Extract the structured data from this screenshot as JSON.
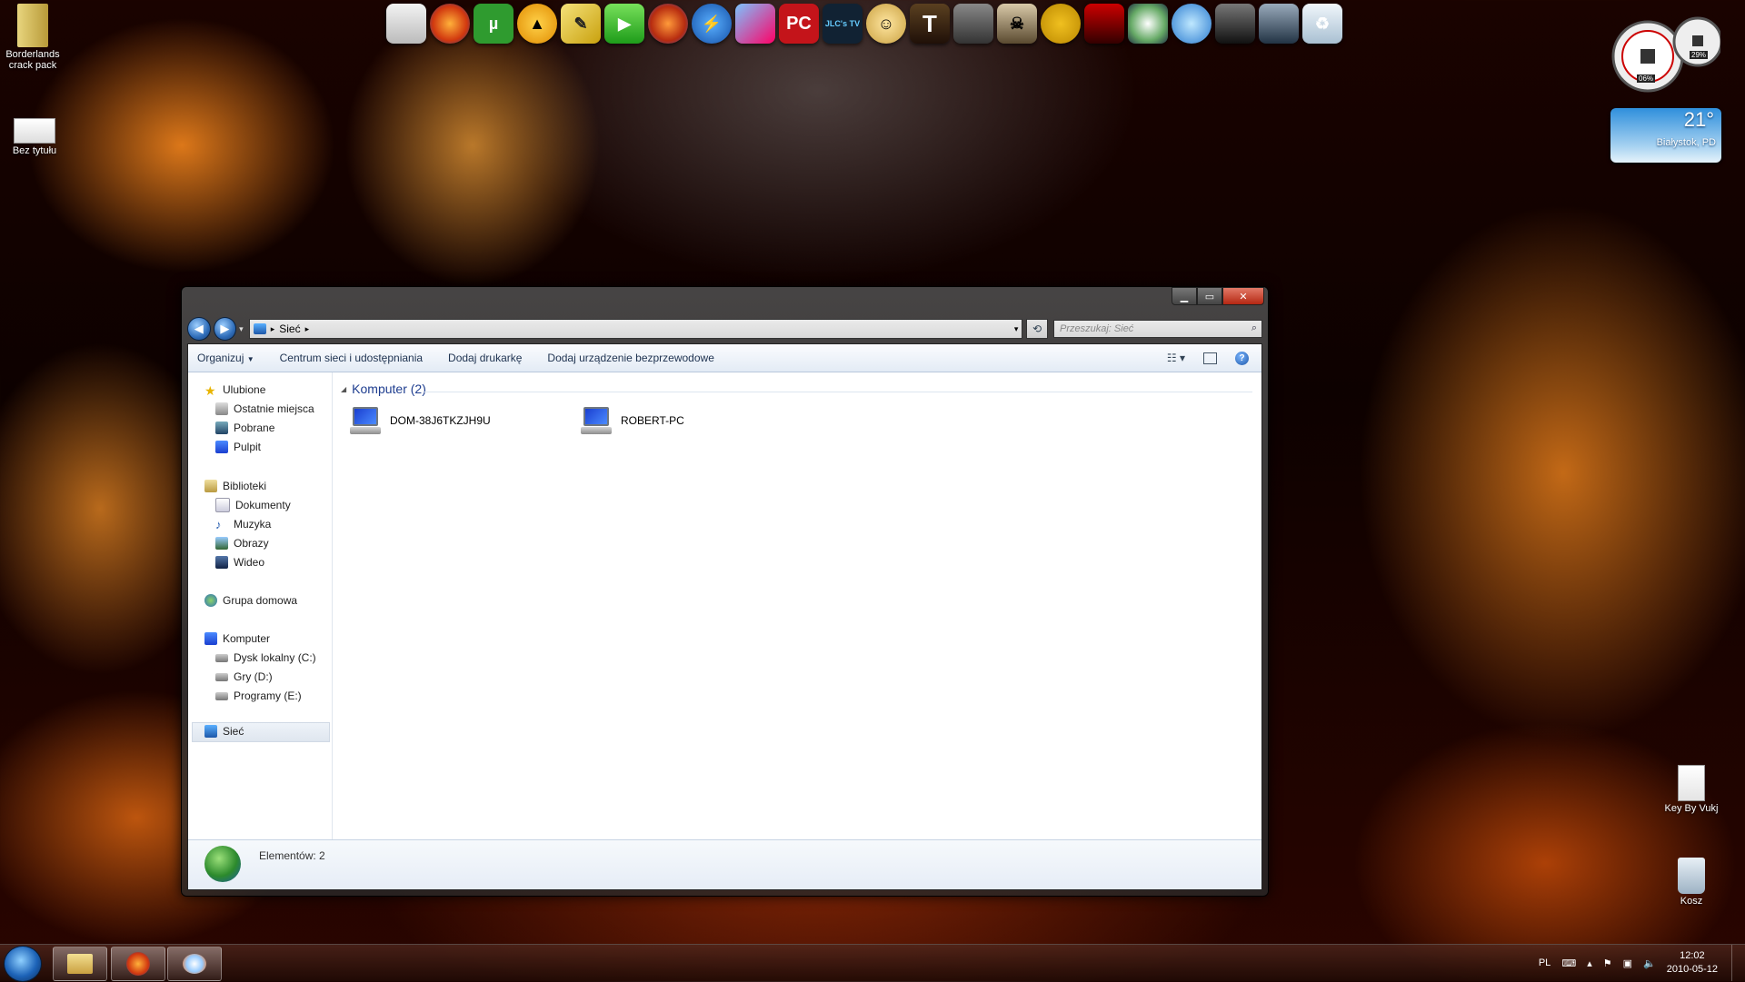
{
  "desktop": {
    "icons": [
      {
        "label": "Borderlands\ncrack pack",
        "name": "borderlands-crack-pack"
      },
      {
        "label": "Bez tytułu",
        "name": "bez-tytulu"
      },
      {
        "label": "Key By Vukj",
        "name": "key-by-vukj"
      },
      {
        "label": "Kosz",
        "name": "kosz"
      }
    ]
  },
  "dock": {
    "icons": [
      "notepad-icon",
      "firefox-icon",
      "utorrent-icon",
      "aimp-icon",
      "pen-icon",
      "play-icon",
      "firefox-alt-icon",
      "lightning-icon",
      "paint-icon",
      "pc-icon",
      "jlc-tv-icon",
      "vault-boy-icon",
      "t-game-icon",
      "just-cause-icon",
      "skull-icon",
      "borderlands-icon",
      "game-red-icon",
      "flower-icon",
      "swirl-icon",
      "shield-icon",
      "soldier-icon",
      "recycle-icon"
    ],
    "labels": {
      "utorrent": "µ",
      "pc": "PC",
      "jlc": "JLC's TV"
    }
  },
  "gadgets": {
    "meter": {
      "cpu": "06%",
      "ram": "29%"
    },
    "weather": {
      "temp": "21°",
      "city": "Białystok, PD"
    }
  },
  "window": {
    "address": {
      "crumb": "Sieć"
    },
    "search": {
      "placeholder": "Przeszukaj: Sieć"
    },
    "toolbar": {
      "organize": "Organizuj",
      "network_center": "Centrum sieci i udostępniania",
      "add_printer": "Dodaj drukarkę",
      "add_wireless": "Dodaj urządzenie bezprzewodowe"
    },
    "nav": {
      "favorites": "Ulubione",
      "recent": "Ostatnie miejsca",
      "downloads": "Pobrane",
      "desktop": "Pulpit",
      "libraries": "Biblioteki",
      "documents": "Dokumenty",
      "music": "Muzyka",
      "pictures": "Obrazy",
      "video": "Wideo",
      "homegroup": "Grupa domowa",
      "computer": "Komputer",
      "drive_c": "Dysk lokalny (C:)",
      "drive_d": "Gry (D:)",
      "drive_e": "Programy (E:)",
      "network": "Sieć"
    },
    "group": {
      "title": "Komputer (2)"
    },
    "computers": [
      {
        "name": "DOM-38J6TKZJH9U"
      },
      {
        "name": "ROBERT-PC"
      }
    ],
    "details": {
      "count": "Elementów: 2"
    }
  },
  "taskbar": {
    "lang": "PL",
    "time": "12:02",
    "date": "2010-05-12"
  }
}
